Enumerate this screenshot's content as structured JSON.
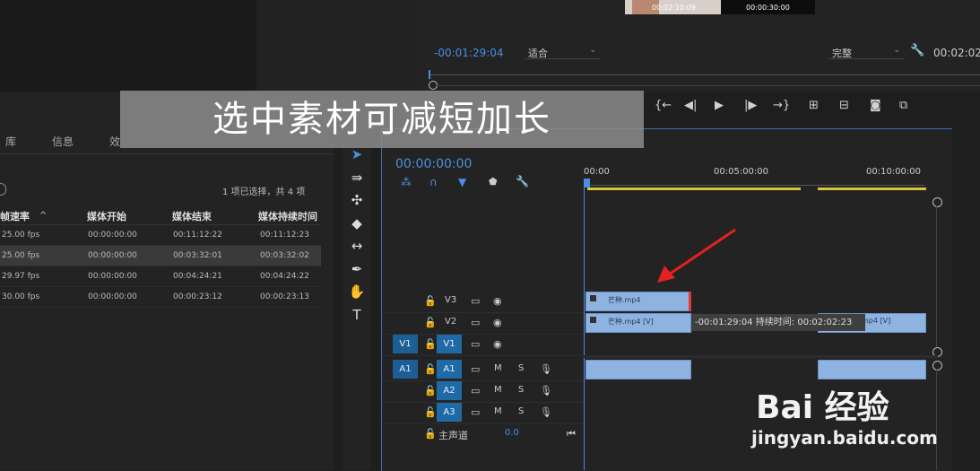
{
  "source_monitor": {
    "thumb1_time": "00:02:10:09",
    "thumb2_time": "00:00:30:00"
  },
  "program_monitor": {
    "timecode": "-00:01:29:04",
    "fit_dropdown": "适合",
    "quality_dropdown": "完整",
    "duration": "00:02:02"
  },
  "overlay_title": "选中素材可减短加长",
  "project_panel": {
    "tabs": [
      "库",
      "信息",
      "效"
    ],
    "selection_info": "1 项已选择，共 4 项",
    "columns": [
      "帧速率",
      "媒体开始",
      "媒体结束",
      "媒体持续时间"
    ],
    "rows": [
      {
        "fps": "25.00 fps",
        "start": "00:00:00:00",
        "end": "00:11:12:22",
        "dur": "00:11:12:23",
        "selected": false
      },
      {
        "fps": "25.00 fps",
        "start": "00:00:00:00",
        "end": "00:03:32:01",
        "dur": "00:03:32:02",
        "selected": true
      },
      {
        "fps": "29.97 fps",
        "start": "00:00:00:00",
        "end": "00:04:24:21",
        "dur": "00:04:24:22",
        "selected": false
      },
      {
        "fps": "30.00 fps",
        "start": "00:00:00:00",
        "end": "00:00:23:12",
        "dur": "00:00:23:13",
        "selected": false
      }
    ]
  },
  "timeline": {
    "timecode": "00:00:00:00",
    "ruler": [
      "00:00",
      "00:05:00:00",
      "00:10:00:00"
    ],
    "tracks": {
      "V3": "V3",
      "V2": "V2",
      "V1": "V1",
      "A1": "A1",
      "A2": "A2",
      "A3": "A3",
      "src_v1": "V1",
      "src_a1": "A1"
    },
    "master_label": "主声道",
    "master_value": "0.0",
    "mute_label": "M",
    "solo_label": "S",
    "clip_v3": "芒种.mp4",
    "clip_v2a": "芒种.mp4 [V]",
    "clip_v2b": "mp4 [V]",
    "trim_tooltip": "-00:01:29:04 持续时间: 00:02:02:23"
  },
  "watermark": {
    "brand": "Bai 经验",
    "url": "jingyan.baidu.com"
  }
}
